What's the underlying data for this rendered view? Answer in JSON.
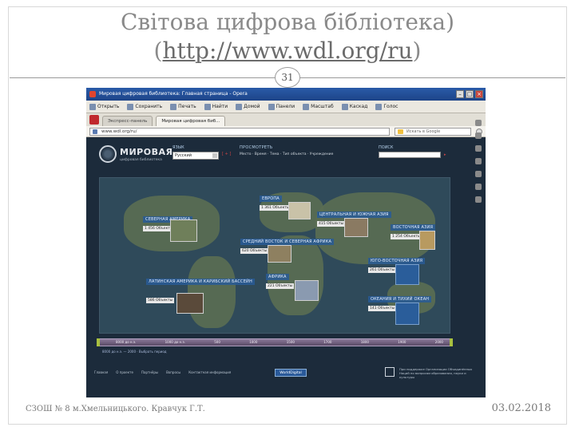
{
  "slide": {
    "title_line1": "Світова цифрова бібліотека)",
    "title_line2_open": "(",
    "title_url": "http://www.wdl.org/ru",
    "title_line2_close": ")",
    "page_number": "31",
    "footer_left": "СЗОШ № 8 м.Хмельницького. Кравчук Г.Т.",
    "footer_date": "03.02.2018"
  },
  "browser": {
    "window_title": "Мировая цифровая библиотека: Главная страница - Opera",
    "toolbar": [
      {
        "label": "Открыть",
        "icon": "folder-icon"
      },
      {
        "label": "Сохранить",
        "icon": "save-icon"
      },
      {
        "label": "Печать",
        "icon": "print-icon"
      },
      {
        "label": "Найти",
        "icon": "find-icon"
      },
      {
        "label": "Домой",
        "icon": "home-icon"
      },
      {
        "label": "Панели",
        "icon": "panels-icon"
      },
      {
        "label": "Масштаб",
        "icon": "zoom-icon"
      },
      {
        "label": "Каскад",
        "icon": "cascade-icon"
      },
      {
        "label": "Голос",
        "icon": "voice-icon"
      }
    ],
    "tabs": [
      {
        "label": "Экспресс-панель"
      },
      {
        "label": "Мировая цифровая биб..."
      }
    ],
    "url": "www.wdl.org/ru/",
    "search_placeholder": "Искать в Google"
  },
  "site": {
    "name": "МИРОВАЯ",
    "subtitle": "цифровая библиотека",
    "lang_label": "ЯЗЫК",
    "lang_value": "Русский",
    "lang_extra": "[ + ]",
    "browse_label": "ПРОСМОТРЕТЬ",
    "browse_links": "Место · Время · Тема · Тип объекта · Учреждение",
    "search_label": "ПОИСК",
    "search_go": "▸",
    "regions": [
      {
        "label": "ЕВРОПА",
        "count": "1 361 Объекты"
      },
      {
        "label": "СЕВЕРНАЯ АМЕРИКА",
        "count": "1 456 Объекты"
      },
      {
        "label": "ЦЕНТРАЛЬНАЯ И ЮЖНАЯ АЗИЯ",
        "count": "415 Объекты"
      },
      {
        "label": "ВОСТОЧНАЯ АЗИЯ",
        "count": "1 254 Объекты"
      },
      {
        "label": "СРЕДНИЙ ВОСТОК И СЕВЕРНАЯ АФРИКА",
        "count": "620 Объекты"
      },
      {
        "label": "ЮГО-ВОСТОЧНАЯ АЗИЯ",
        "count": "261 Объекты"
      },
      {
        "label": "ЛАТИНСКАЯ АМЕРИКА И КАРИБСКИЙ БАССЕЙН",
        "count": "586 Объекты"
      },
      {
        "label": "АФРИКА",
        "count": "221 Объекты"
      },
      {
        "label": "ОКЕАНИЯ И ТИХИЙ ОКЕАН",
        "count": "141 Объекты"
      }
    ],
    "timeline_years": [
      "8000 до н.э.",
      "1000 до н.э.",
      "500",
      "1000",
      "1500",
      "1700",
      "1800",
      "1900",
      "2000"
    ],
    "timeline_sub": "8000 до н.э. — 2000 · Выбрать период",
    "footer_links": [
      "Главная",
      "О проекте",
      "Партнёры",
      "Вопросы",
      "Контактная информация"
    ],
    "footer_badge": "WorldDigital",
    "footer_text": "При поддержке Организации Объединённых Наций по вопросам образования, науки и культуры"
  }
}
